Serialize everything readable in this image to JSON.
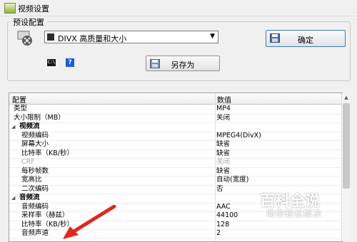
{
  "window": {
    "title": "视频设置"
  },
  "preset": {
    "group_label": "预设配置",
    "selected": "DIVX 高质量和大小",
    "ok_label": "确定",
    "save_as_label": "另存为",
    "cmd_icon_text": "C:\\"
  },
  "grid": {
    "headers": {
      "name": "配置",
      "value": "数值"
    },
    "rows": [
      {
        "name": "类型",
        "value": "MP4"
      },
      {
        "name": "大小限制（MB）",
        "value": "关闭"
      },
      {
        "name": "视频流",
        "value": ""
      },
      {
        "name": "视频编码",
        "value": "MPEG4(DivX)"
      },
      {
        "name": "屏幕大小",
        "value": "缺省"
      },
      {
        "name": "比特率（KB/秒）",
        "value": "缺省"
      },
      {
        "name": "CRF",
        "value": "关闭"
      },
      {
        "name": "每秒帧数",
        "value": "缺省"
      },
      {
        "name": "宽高比",
        "value": "自动(宽度)"
      },
      {
        "name": "二次编码",
        "value": "否"
      },
      {
        "name": "音频流",
        "value": ""
      },
      {
        "name": "音频编码",
        "value": "AAC"
      },
      {
        "name": "采样率（赫兹）",
        "value": "44100"
      },
      {
        "name": "比特率（KB/秒）",
        "value": "128"
      },
      {
        "name": "音频声道",
        "value": "2"
      }
    ]
  },
  "watermark": {
    "logo": "百科全说",
    "tagline": "助你轻松解决"
  },
  "colors": {
    "arrow": "#e0281e",
    "ok_border": "#3c7fb1",
    "help_icon": "#1e5bd6"
  }
}
